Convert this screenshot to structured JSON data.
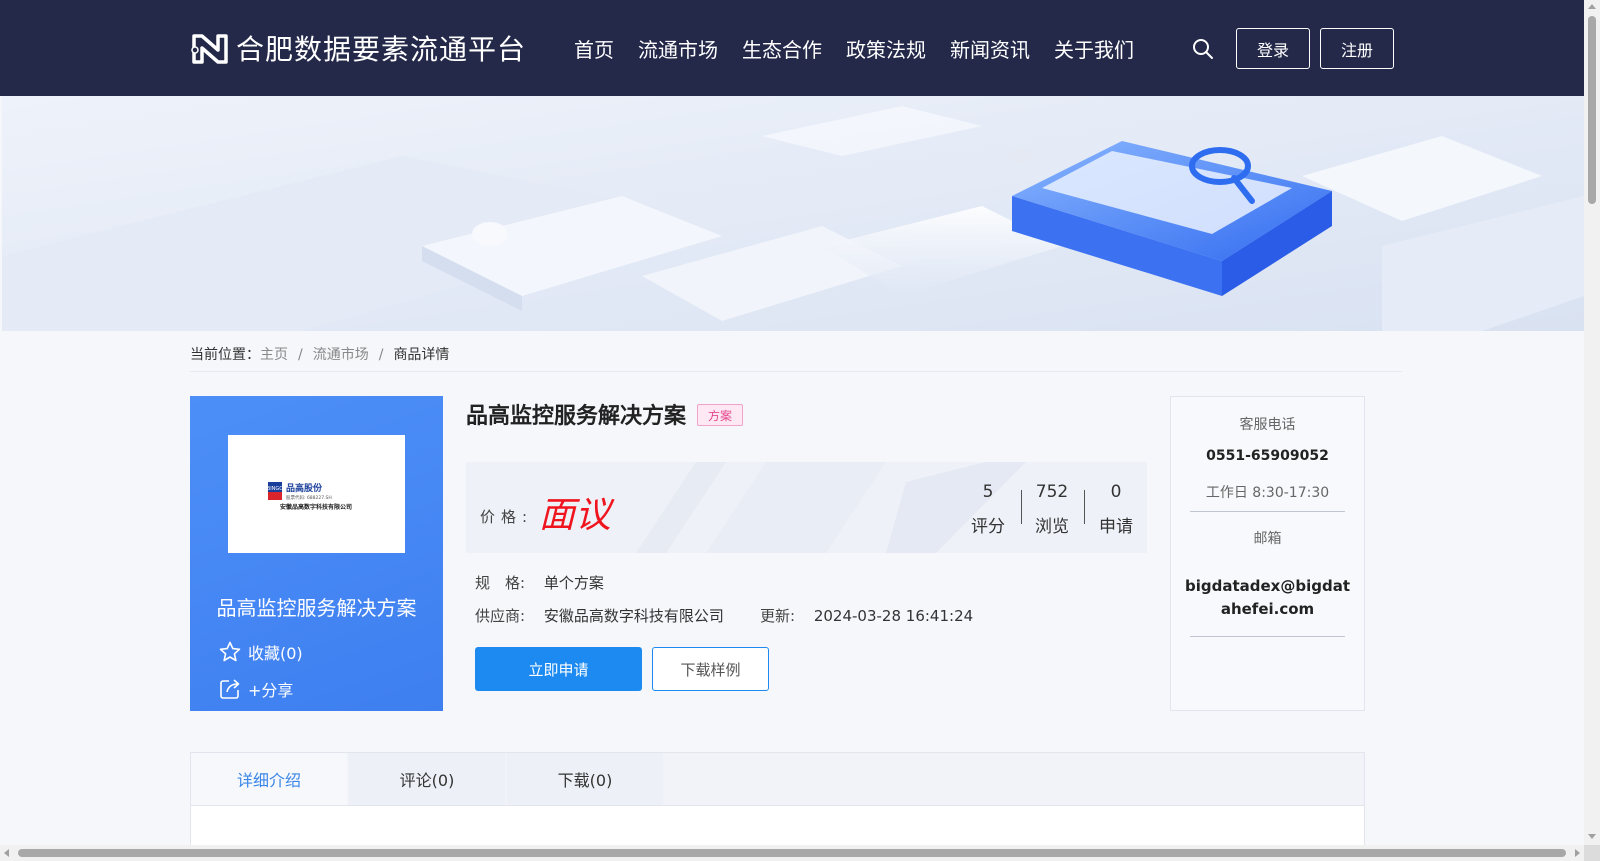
{
  "header": {
    "logo_text": "合肥数据要素流通平台",
    "nav": [
      "首页",
      "流通市场",
      "生态合作",
      "政策法规",
      "新闻资讯",
      "关于我们"
    ],
    "login_label": "登录",
    "register_label": "注册"
  },
  "breadcrumb": {
    "prefix": "当前位置：",
    "home": "主页",
    "market": "流通市场",
    "current": "商品详情",
    "separator": "/"
  },
  "product": {
    "title": "品高监控服务解决方案",
    "tag": "方案",
    "card_title": "品高监控服务解决方案",
    "logo_company_cn": "品高股份",
    "logo_stock": "股票代码: 688227.SH",
    "logo_company_full": "安徽品高数字科技有限公司",
    "logo_brand": "BINGO",
    "favorite_label": "收藏(0)",
    "share_label": "+分享",
    "price_label": "价格:",
    "price_value": "面议",
    "stats": [
      {
        "value": "5",
        "label": "评分"
      },
      {
        "value": "752",
        "label": "浏览"
      },
      {
        "value": "0",
        "label": "申请"
      }
    ],
    "spec_label": "规　格:",
    "spec_value": "单个方案",
    "supplier_label": "供应商:",
    "supplier_value": "安徽品高数字科技有限公司",
    "updated_label": "更新:",
    "updated_value": "2024-03-28 16:41:24",
    "apply_label": "立即申请",
    "download_sample_label": "下载样例"
  },
  "contact": {
    "phone_label": "客服电话",
    "phone": "0551-65909052",
    "hours": "工作日 8:30-17:30",
    "email_label": "邮箱",
    "email": "bigdatadex@bigdatahefei.com"
  },
  "tabs": [
    "详细介绍",
    "评论(0)",
    "下载(0)"
  ],
  "colors": {
    "header_bg": "#24294a",
    "accent": "#1c8af0",
    "price": "#f0141e",
    "card_bg": "#4d8ff8"
  }
}
